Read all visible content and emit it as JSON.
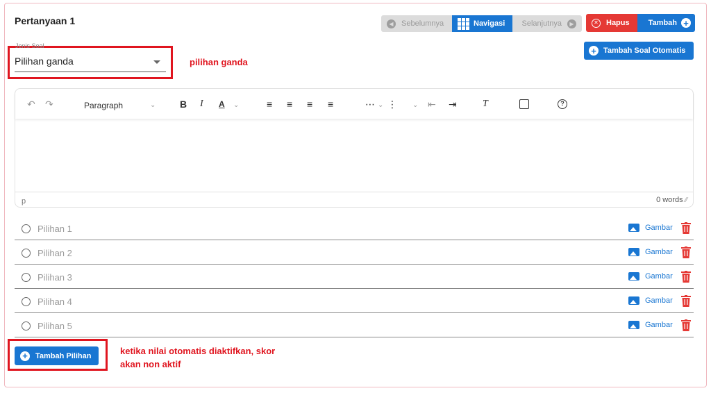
{
  "question": {
    "title": "Pertanyaan 1"
  },
  "nav": {
    "prev_label": "Sebelumnya",
    "nav_label": "Navigasi",
    "next_label": "Selanjutnya"
  },
  "actions": {
    "delete_label": "Hapus",
    "add_label": "Tambah",
    "auto_label": "Tambah Soal Otomatis"
  },
  "question_type": {
    "label": "Jenis Soal",
    "value": "Pilihan ganda"
  },
  "editor": {
    "paragraph_label": "Paragraph",
    "status_element": "p",
    "word_count": "0 words"
  },
  "choices": [
    {
      "label": "Pilihan 1",
      "image_label": "Gambar"
    },
    {
      "label": "Pilihan 2",
      "image_label": "Gambar"
    },
    {
      "label": "Pilihan 3",
      "image_label": "Gambar"
    },
    {
      "label": "Pilihan 4",
      "image_label": "Gambar"
    },
    {
      "label": "Pilihan 5",
      "image_label": "Gambar"
    }
  ],
  "add_choice_label": "Tambah Pilihan",
  "annotations": {
    "type_note": "pilihan ganda",
    "score_note_line1": "ketika nilai otomatis diaktifkan, skor",
    "score_note_line2": "akan non aktif"
  },
  "colors": {
    "primary": "#1976d2",
    "danger": "#e53935",
    "annotation": "#e0151f",
    "disabled": "#dcdcdc"
  }
}
